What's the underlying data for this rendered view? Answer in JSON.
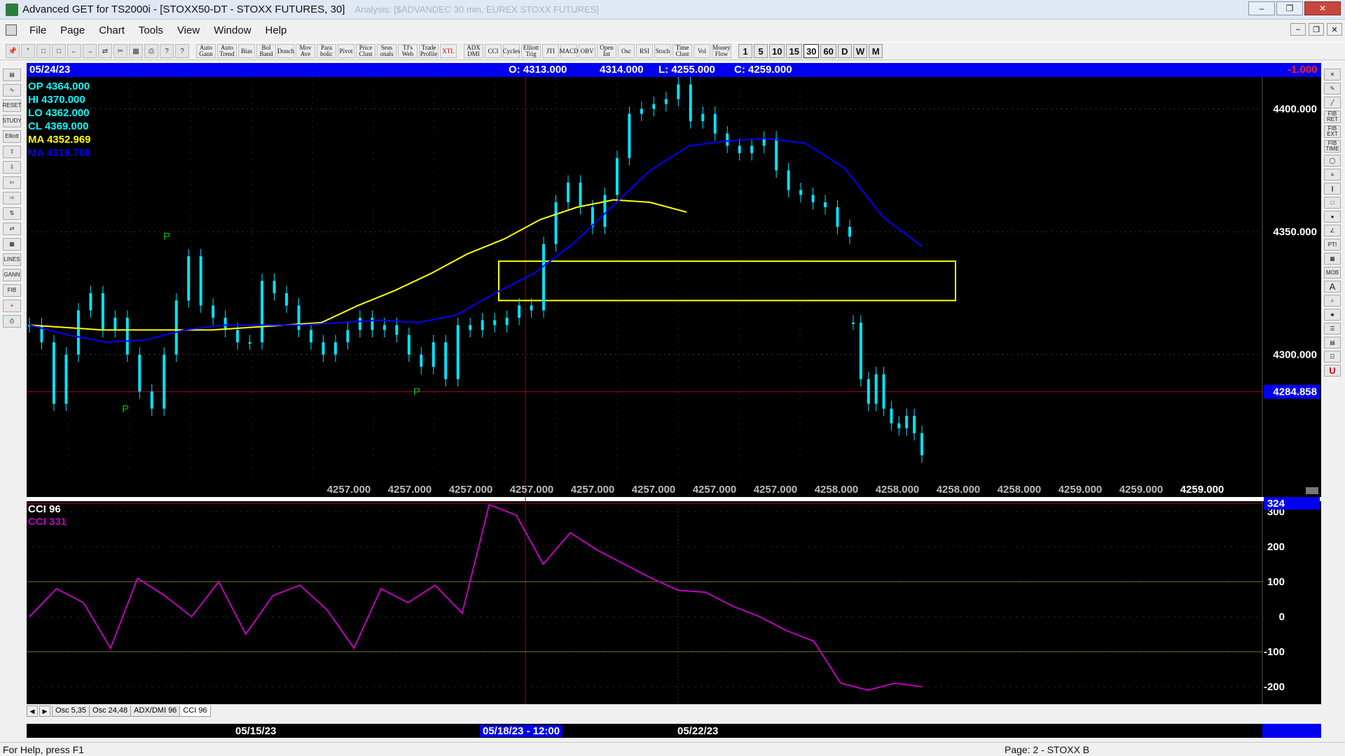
{
  "window": {
    "title": "Advanced GET for TS2000i - [STOXX50-DT - STOXX FUTURES, 30]",
    "faded_title": "Analysis: [$ADVANDEC 30 min, EUREX STOXX FUTURES]",
    "controls": [
      "minimize",
      "restore",
      "close"
    ]
  },
  "menu": [
    "File",
    "Page",
    "Chart",
    "Tools",
    "View",
    "Window",
    "Help"
  ],
  "toolbar": {
    "file_icons": [
      "pin-icon",
      "quote-icon",
      "open-icon",
      "copy-icon",
      "back-icon",
      "forward-icon",
      "swap-icon",
      "cut-icon",
      "grid-icon",
      "print-icon",
      "hint-icon",
      "help-icon"
    ],
    "studies": [
      "Auto Gann",
      "Auto Trend",
      "Bias",
      "Bol Band",
      "Donch",
      "Mov Ave",
      "Para bolic",
      "Pivot",
      "Price Clust",
      "Seas onals",
      "TJ's Web",
      "Trade Profile",
      "XTL",
      "ADX DMI",
      "CCI",
      "Cycles",
      "Elliott Trig",
      "JTI",
      "MACD",
      "OBV",
      "Open Int",
      "Osc",
      "RSI",
      "Stoch",
      "Time Clust",
      "Vol",
      "Money Flow"
    ],
    "intervals": [
      "1",
      "5",
      "10",
      "15",
      "30",
      "60",
      "D",
      "W",
      "M"
    ],
    "active_interval": "30"
  },
  "left_tools": [
    "open-icon",
    "wave-icon",
    "reset-icon",
    "study-icon",
    "elliott-icon",
    "up-arrow-icon",
    "down-arrow-icon",
    "left-arrow-icon",
    "right-arrow-icon",
    "compress-icon",
    "expand-icon",
    "grid-icon",
    "lines-icon",
    "gann-icon",
    "fib-icon",
    "cross-icon",
    "print-icon"
  ],
  "right_tools": [
    "cursor-icon",
    "pencil-icon",
    "line-icon",
    "fib-ret-icon",
    "fib-ext-icon",
    "fib-time-icon",
    "ellipse-icon",
    "fan-icon",
    "channel-icon",
    "box-icon",
    "circle-icon",
    "angle-icon",
    "pti-icon",
    "grid-icon",
    "mob-icon",
    "text-icon",
    "zoom-icon",
    "paint-icon",
    "list-icon",
    "page-icon",
    "notes-icon",
    "u-icon"
  ],
  "infobar": {
    "date": "05/24/23",
    "open": "O: 4313.000",
    "high": "4314.000",
    "low": "L: 4255.000",
    "close": "C: 4259.000",
    "change": "-1.000"
  },
  "legend": [
    {
      "label": "OP",
      "value": "4364.000",
      "color": "#00ffff"
    },
    {
      "label": "HI",
      "value": "4370.000",
      "color": "#00ffff"
    },
    {
      "label": "LO",
      "value": "4362.000",
      "color": "#00ffff"
    },
    {
      "label": "CL",
      "value": "4369.000",
      "color": "#00ffff"
    },
    {
      "label": "MA",
      "value": "4352.969",
      "color": "#ffff00"
    },
    {
      "label": "MA",
      "value": "4319.708",
      "color": "#0000ff"
    }
  ],
  "price_axis": {
    "ticks": [
      "4400.000",
      "4350.000",
      "4300.000"
    ],
    "highlight": "4284.858"
  },
  "bottom_values": [
    "4257.000",
    "4257.000",
    "4257.000",
    "4257.000",
    "4257.000",
    "4257.000",
    "4257.000",
    "4257.000",
    "4258.000",
    "4258.000",
    "4258.000",
    "4258.000",
    "4259.000",
    "4259.000",
    "4259.000"
  ],
  "pivot_markers": [
    "P",
    "P",
    "P"
  ],
  "cci": {
    "title": "CCI 96",
    "value_label": "CCI  331",
    "badge": "324",
    "ticks": [
      "300",
      "200",
      "100",
      "0",
      "-100",
      "-200"
    ]
  },
  "osc_tabs": [
    "Osc 5,35",
    "Osc 24,48",
    "ADX/DMI 96",
    "CCI 96"
  ],
  "active_osc_tab": "CCI 96",
  "date_axis": {
    "d1": "05/15/23",
    "d2": "05/18/23 - 12:00",
    "d3": "05/22/23"
  },
  "status": {
    "left": "For Help, press F1",
    "right": "Page: 2 - STOXX B"
  },
  "chart_data": {
    "type": "line",
    "title": "STOXX50-DT - STOXX FUTURES, 30",
    "price": {
      "ylim": [
        4250,
        4413
      ],
      "ticks": [
        4300,
        4350,
        4400
      ],
      "close_points": [
        4312,
        4305,
        4280,
        4300,
        4318,
        4325,
        4310,
        4315,
        4300,
        4285,
        4278,
        4300,
        4322,
        4340,
        4320,
        4315,
        4310,
        4305,
        4305,
        4330,
        4325,
        4320,
        4310,
        4305,
        4300,
        4305,
        4310,
        4315,
        4310,
        4312,
        4308,
        4300,
        4295,
        4305,
        4290,
        4312,
        4310,
        4314,
        4312,
        4315,
        4320,
        4318,
        4345,
        4362,
        4370,
        4360,
        4352,
        4365,
        4380,
        4398,
        4400,
        4402,
        4404,
        4410,
        4395,
        4398,
        4390,
        4385,
        4382,
        4385,
        4388,
        4375,
        4367,
        4365,
        4362,
        4360,
        4352,
        4348
      ],
      "ma_yellow": [
        4312,
        4311,
        4310,
        4310,
        4310,
        4310,
        4311,
        4312,
        4313,
        4320,
        4326,
        4333,
        4341,
        4347,
        4355,
        4360,
        4363,
        4362,
        4358
      ],
      "ma_blue": [
        4312,
        4308,
        4305,
        4306,
        4310,
        4312,
        4312,
        4312,
        4313,
        4314,
        4313,
        4316,
        4325,
        4333,
        4345,
        4360,
        4375,
        4385,
        4387,
        4388,
        4386,
        4376,
        4356,
        4344
      ],
      "reference_line": 4284.858,
      "post_gap_points": [
        4313,
        4290,
        4280,
        4292,
        4278,
        4272,
        4270,
        4275,
        4268,
        4259
      ],
      "highlight_box": [
        4322,
        4338
      ]
    },
    "cci": {
      "ylim": [
        -250,
        330
      ],
      "levels": [
        -100,
        100
      ],
      "values": [
        0,
        80,
        40,
        -90,
        110,
        60,
        0,
        100,
        -50,
        60,
        90,
        20,
        -90,
        80,
        40,
        90,
        10,
        320,
        290,
        150,
        240,
        190,
        150,
        110,
        75,
        70,
        30,
        0,
        -40,
        -70,
        -190,
        -210,
        -190,
        -200
      ]
    }
  }
}
